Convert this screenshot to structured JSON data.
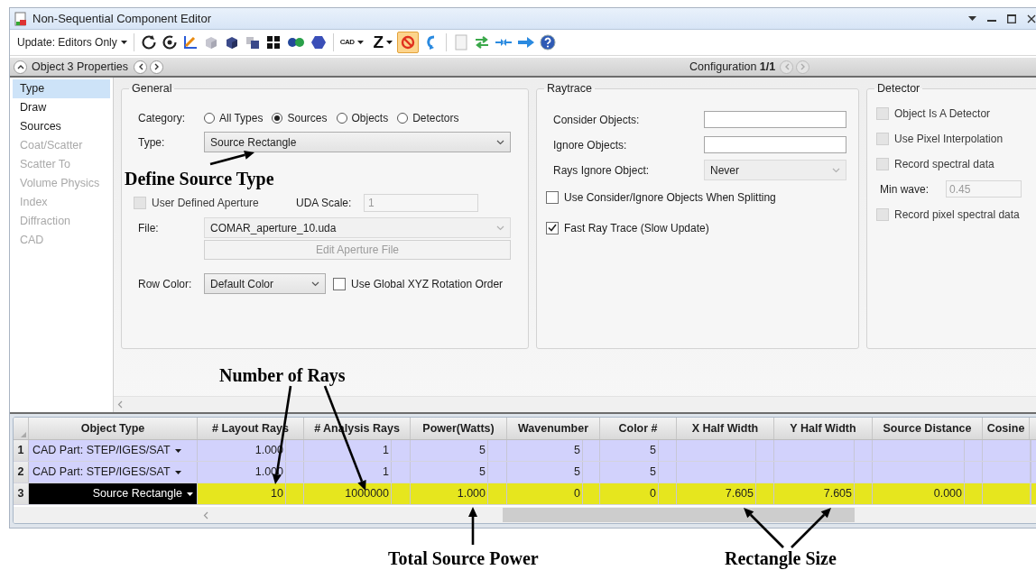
{
  "window": {
    "title": "Non-Sequential Component Editor"
  },
  "toolbar": {
    "update_mode": "Update: Editors Only",
    "cad": "CAD",
    "z": "Z",
    "stop_button": {
      "active": true
    }
  },
  "properties_bar": {
    "title": "Object 3 Properties",
    "configuration_label": "Configuration",
    "configuration_value": "1/1"
  },
  "sidebar": {
    "items": [
      {
        "label": "Type",
        "selected": true,
        "disabled": false
      },
      {
        "label": "Draw",
        "selected": false,
        "disabled": false
      },
      {
        "label": "Sources",
        "selected": false,
        "disabled": false
      },
      {
        "label": "Coat/Scatter",
        "selected": false,
        "disabled": true
      },
      {
        "label": "Scatter To",
        "selected": false,
        "disabled": true
      },
      {
        "label": "Volume Physics",
        "selected": false,
        "disabled": true
      },
      {
        "label": "Index",
        "selected": false,
        "disabled": true
      },
      {
        "label": "Diffraction",
        "selected": false,
        "disabled": true
      },
      {
        "label": "CAD",
        "selected": false,
        "disabled": true
      }
    ]
  },
  "general": {
    "title": "General",
    "category_label": "Category:",
    "categories": [
      {
        "label": "All Types",
        "selected": false
      },
      {
        "label": "Sources",
        "selected": true
      },
      {
        "label": "Objects",
        "selected": false
      },
      {
        "label": "Detectors",
        "selected": false
      }
    ],
    "type_label": "Type:",
    "type_value": "Source Rectangle",
    "uda": {
      "label": "User Defined Aperture",
      "checked": false,
      "disabled": true
    },
    "uda_scale": {
      "label": "UDA Scale:",
      "value": "1",
      "disabled": true
    },
    "file": {
      "label": "File:",
      "value": "COMAR_aperture_10.uda",
      "disabled": true
    },
    "edit_button": {
      "label": "Edit Aperture File",
      "disabled": true
    },
    "row_color": {
      "label": "Row Color:",
      "value": "Default Color"
    },
    "global_xyz": {
      "label": "Use Global XYZ Rotation Order",
      "checked": false,
      "disabled": false
    }
  },
  "raytrace": {
    "title": "Raytrace",
    "fields": [
      {
        "kind": "text",
        "label": "Consider Objects:",
        "disabled": false
      },
      {
        "kind": "text",
        "label": "Ignore Objects:",
        "disabled": false
      },
      {
        "kind": "select",
        "label": "Rays Ignore Object:",
        "value": "Never",
        "disabled": true
      }
    ],
    "checkboxes": [
      {
        "label": "Use Consider/Ignore Objects When Splitting",
        "checked": false,
        "disabled": false
      },
      {
        "label": "Fast Ray Trace (Slow Update)",
        "checked": true,
        "disabled": false
      }
    ]
  },
  "detector": {
    "title": "Detector",
    "items": [
      {
        "kind": "checkbox",
        "label": "Object Is A Detector",
        "checked": false,
        "disabled": true
      },
      {
        "kind": "checkbox",
        "label": "Use Pixel Interpolation",
        "checked": false,
        "disabled": true
      },
      {
        "kind": "checkbox",
        "label": "Record spectral data",
        "checked": false,
        "disabled": true
      },
      {
        "kind": "field",
        "label": "Min wave:",
        "value": "0.45",
        "disabled": true
      },
      {
        "kind": "checkbox",
        "label": "Record pixel spectral data",
        "checked": false,
        "disabled": true
      }
    ]
  },
  "table": {
    "columns": [
      "Object Type",
      "# Layout Rays",
      "# Analysis Rays",
      "Power(Watts)",
      "Wavenumber",
      "Color #",
      "X Half Width",
      "Y Half Width",
      "Source Distance",
      "Cosine"
    ],
    "rows": [
      {
        "number": "1",
        "object_type": "CAD Part: STEP/IGES/SAT",
        "selected": false,
        "values": [
          "1.000",
          "1",
          "5",
          "5",
          "5"
        ]
      },
      {
        "number": "2",
        "object_type": "CAD Part: STEP/IGES/SAT",
        "selected": false,
        "values": [
          "1.000",
          "1",
          "5",
          "5",
          "5"
        ]
      },
      {
        "number": "3",
        "object_type": "Source Rectangle",
        "selected": true,
        "values": [
          "10",
          "1000000",
          "1.000",
          "0",
          "0",
          "7.605",
          "7.605",
          "0.000"
        ]
      }
    ]
  },
  "annotations": [
    {
      "text": "Define Source Type"
    },
    {
      "text": "Number of Rays"
    },
    {
      "text": "Total Source Power"
    },
    {
      "text": "Rectangle Size"
    }
  ]
}
